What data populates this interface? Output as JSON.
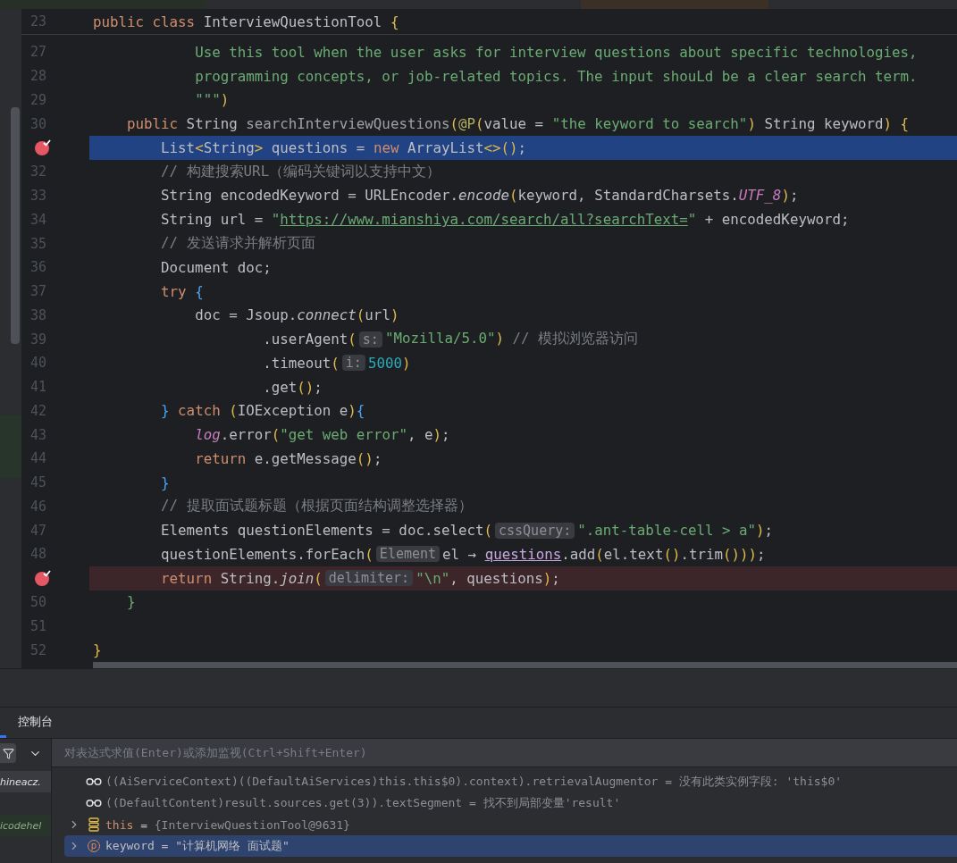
{
  "editor": {
    "sticky_line": {
      "number": "23",
      "tokens": [
        {
          "kind": "kw",
          "text": "public class"
        },
        {
          "kind": "plain",
          "text": " InterviewQuestionTool "
        },
        {
          "kind": "py",
          "text": "{"
        }
      ]
    },
    "lines": [
      {
        "children": [
          {
            "children": [
              {
                "children": [
                  {
                    "number": "27",
                    "breakpoint": false,
                    "current": false,
                    "tokens": [
                      {
                        "kind": "str",
                        "text": "Use this tool when the user asks for interview questions about specific technologies,"
                      }
                    ]
                  },
                  {
                    "number": "28",
                    "breakpoint": false,
                    "current": false,
                    "tokens": [
                      {
                        "kind": "str",
                        "text": "programming concepts, or job-related topics. The input shouLd be a clear search term."
                      }
                    ]
                  },
                  {
                    "number": "29",
                    "breakpoint": false,
                    "current": false,
                    "tokens": [
                      {
                        "kind": "str",
                        "text": "\"\"\""
                      },
                      {
                        "kind": "py",
                        "text": ")"
                      }
                    ]
                  }
                ]
              }
            ]
          }
        ]
      },
      {
        "children": [
          {
            "number": "30",
            "breakpoint": false,
            "current": false,
            "tokens": [
              {
                "kind": "kw",
                "text": "public"
              },
              {
                "kind": "plain",
                "text": " String "
              },
              {
                "kind": "decl",
                "text": "searchInterviewQuestions"
              },
              {
                "kind": "py",
                "text": "("
              },
              {
                "kind": "an",
                "text": "@P"
              },
              {
                "kind": "py",
                "text": "("
              },
              {
                "kind": "plain",
                "text": "value = "
              },
              {
                "kind": "str",
                "text": "\"the keyword to search\""
              },
              {
                "kind": "py",
                "text": ")"
              },
              {
                "kind": "plain",
                "text": " String keyword"
              },
              {
                "kind": "py",
                "text": ") {"
              }
            ],
            "children": [
              {
                "breakpoint": true,
                "current": true,
                "tokens": [
                  {
                    "kind": "plain",
                    "text": "List"
                  },
                  {
                    "kind": "py",
                    "text": "<"
                  },
                  {
                    "kind": "plain",
                    "text": "String"
                  },
                  {
                    "kind": "py",
                    "text": ">"
                  },
                  {
                    "kind": "plain",
                    "text": " questions = "
                  },
                  {
                    "kind": "kw",
                    "text": "new"
                  },
                  {
                    "kind": "plain",
                    "text": " ArrayList"
                  },
                  {
                    "kind": "py",
                    "text": "<>()"
                  },
                  {
                    "kind": "plain",
                    "text": ";"
                  }
                ]
              },
              {
                "number": "32",
                "breakpoint": false,
                "current": false,
                "tokens": [
                  {
                    "kind": "cm",
                    "text": "// 构建搜索URL（编码关键词以支持中文）"
                  }
                ]
              },
              {
                "number": "33",
                "breakpoint": false,
                "current": false,
                "tokens": [
                  {
                    "kind": "plain",
                    "text": "String encodedKeyword = URLEncoder."
                  },
                  {
                    "kind": "it",
                    "text": "encode"
                  },
                  {
                    "kind": "py",
                    "text": "("
                  },
                  {
                    "kind": "plain",
                    "text": "keyword, StandardCharsets."
                  },
                  {
                    "kind": "st",
                    "text": "UTF_8"
                  },
                  {
                    "kind": "py",
                    "text": ")"
                  },
                  {
                    "kind": "plain",
                    "text": ";"
                  }
                ]
              },
              {
                "number": "34",
                "breakpoint": false,
                "current": false,
                "tokens": [
                  {
                    "kind": "plain",
                    "text": "String url = "
                  },
                  {
                    "kind": "str",
                    "text": "\""
                  },
                  {
                    "kind": "link",
                    "text": "https://www.mianshiya.com/search/all?searchText="
                  },
                  {
                    "kind": "str",
                    "text": "\""
                  },
                  {
                    "kind": "plain",
                    "text": " + encodedKeyword;"
                  }
                ]
              },
              {
                "number": "35",
                "breakpoint": false,
                "current": false,
                "tokens": [
                  {
                    "kind": "cm",
                    "text": "// 发送请求并解析页面"
                  }
                ]
              },
              {
                "number": "36",
                "breakpoint": false,
                "current": false,
                "tokens": [
                  {
                    "kind": "plain",
                    "text": "Document doc;"
                  }
                ]
              },
              {
                "number": "37",
                "breakpoint": false,
                "current": false,
                "tokens": [
                  {
                    "kind": "kw",
                    "text": "try"
                  },
                  {
                    "kind": "pb",
                    "text": " {"
                  }
                ],
                "children": [
                  {
                    "number": "38",
                    "breakpoint": false,
                    "current": false,
                    "tokens": [
                      {
                        "kind": "plain",
                        "text": "doc = Jsoup."
                      },
                      {
                        "kind": "it",
                        "text": "connect"
                      },
                      {
                        "kind": "py",
                        "text": "("
                      },
                      {
                        "kind": "plain",
                        "text": "url"
                      },
                      {
                        "kind": "py",
                        "text": ")"
                      }
                    ],
                    "children": [
                      {
                        "children": [
                          {
                            "number": "39",
                            "breakpoint": false,
                            "current": false,
                            "tokens": [
                              {
                                "kind": "plain",
                                "text": ".userAgent"
                              },
                              {
                                "kind": "py",
                                "text": "("
                              },
                              {
                                "kind": "hint",
                                "text": "s:"
                              },
                              {
                                "kind": "str",
                                "text": "\"Mozilla/5.0\""
                              },
                              {
                                "kind": "py",
                                "text": ")"
                              },
                              {
                                "kind": "cm",
                                "text": " // 模拟浏览器访问"
                              }
                            ]
                          },
                          {
                            "number": "40",
                            "breakpoint": false,
                            "current": false,
                            "tokens": [
                              {
                                "kind": "plain",
                                "text": ".timeout"
                              },
                              {
                                "kind": "py",
                                "text": "("
                              },
                              {
                                "kind": "hint",
                                "text": "i:"
                              },
                              {
                                "kind": "num",
                                "text": "5000"
                              },
                              {
                                "kind": "py",
                                "text": ")"
                              }
                            ]
                          },
                          {
                            "number": "41",
                            "breakpoint": false,
                            "current": false,
                            "tokens": [
                              {
                                "kind": "plain",
                                "text": ".get"
                              },
                              {
                                "kind": "py",
                                "text": "()"
                              },
                              {
                                "kind": "plain",
                                "text": ";"
                              }
                            ]
                          }
                        ]
                      }
                    ]
                  }
                ]
              },
              {
                "number": "42",
                "breakpoint": false,
                "current": false,
                "tokens": [
                  {
                    "kind": "pb",
                    "text": "} "
                  },
                  {
                    "kind": "kw",
                    "text": "catch"
                  },
                  {
                    "kind": "py",
                    "text": " ("
                  },
                  {
                    "kind": "plain",
                    "text": "IOException e"
                  },
                  {
                    "kind": "py",
                    "text": ")"
                  },
                  {
                    "kind": "pb",
                    "text": "{"
                  }
                ],
                "children": [
                  {
                    "number": "43",
                    "breakpoint": false,
                    "current": false,
                    "tokens": [
                      {
                        "kind": "st",
                        "text": "log"
                      },
                      {
                        "kind": "plain",
                        "text": ".error"
                      },
                      {
                        "kind": "py",
                        "text": "("
                      },
                      {
                        "kind": "str",
                        "text": "\"get web error\""
                      },
                      {
                        "kind": "plain",
                        "text": ", e"
                      },
                      {
                        "kind": "py",
                        "text": ")"
                      },
                      {
                        "kind": "plain",
                        "text": ";"
                      }
                    ]
                  },
                  {
                    "number": "44",
                    "breakpoint": false,
                    "current": false,
                    "tokens": [
                      {
                        "kind": "kw",
                        "text": "return"
                      },
                      {
                        "kind": "plain",
                        "text": " e.getMessage"
                      },
                      {
                        "kind": "py",
                        "text": "()"
                      },
                      {
                        "kind": "plain",
                        "text": ";"
                      }
                    ]
                  }
                ]
              },
              {
                "number": "45",
                "breakpoint": false,
                "current": false,
                "tokens": [
                  {
                    "kind": "pb",
                    "text": "}"
                  }
                ]
              },
              {
                "number": "46",
                "breakpoint": false,
                "current": false,
                "tokens": [
                  {
                    "kind": "cm",
                    "text": "// 提取面试题标题（根据页面结构调整选择器）"
                  }
                ]
              },
              {
                "number": "47",
                "breakpoint": false,
                "current": false,
                "tokens": [
                  {
                    "kind": "plain",
                    "text": "Elements questionElements = doc.select"
                  },
                  {
                    "kind": "py",
                    "text": "("
                  },
                  {
                    "kind": "hint",
                    "text": "cssQuery:"
                  },
                  {
                    "kind": "str",
                    "text": "\".ant-table-cell > a\""
                  },
                  {
                    "kind": "py",
                    "text": ")"
                  },
                  {
                    "kind": "plain",
                    "text": ";"
                  }
                ]
              },
              {
                "number": "48",
                "breakpoint": false,
                "current": false,
                "tokens": [
                  {
                    "kind": "plain",
                    "text": "questionElements.forEach"
                  },
                  {
                    "kind": "py",
                    "text": "("
                  },
                  {
                    "kind": "hint",
                    "text": "Element"
                  },
                  {
                    "kind": "plain",
                    "text": "el → "
                  },
                  {
                    "kind": "cap",
                    "text": "questions"
                  },
                  {
                    "kind": "plain",
                    "text": ".add"
                  },
                  {
                    "kind": "py",
                    "text": "("
                  },
                  {
                    "kind": "plain",
                    "text": "el.text"
                  },
                  {
                    "kind": "py",
                    "text": "()"
                  },
                  {
                    "kind": "plain",
                    "text": ".trim"
                  },
                  {
                    "kind": "py",
                    "text": "()))"
                  },
                  {
                    "kind": "plain",
                    "text": ";"
                  }
                ]
              },
              {
                "breakpoint": true,
                "current": false,
                "tokens": [
                  {
                    "kind": "kw",
                    "text": "return"
                  },
                  {
                    "kind": "plain",
                    "text": " String."
                  },
                  {
                    "kind": "it",
                    "text": "join"
                  },
                  {
                    "kind": "py",
                    "text": "("
                  },
                  {
                    "kind": "hint",
                    "text": "delimiter:"
                  },
                  {
                    "kind": "str",
                    "text": "\"\\n\""
                  },
                  {
                    "kind": "plain",
                    "text": ", questions"
                  },
                  {
                    "kind": "py",
                    "text": ")"
                  },
                  {
                    "kind": "plain",
                    "text": ";"
                  }
                ]
              }
            ]
          },
          {
            "number": "50",
            "breakpoint": false,
            "current": false,
            "tokens": [
              {
                "kind": "pg",
                "text": "}"
              }
            ]
          }
        ]
      },
      {
        "number": "51",
        "breakpoint": false,
        "current": false
      },
      {
        "number": "52",
        "breakpoint": false,
        "current": false,
        "tokens": [
          {
            "kind": "py",
            "text": "}"
          }
        ]
      }
    ]
  },
  "debug_panel": {
    "tabs": [
      {
        "label": "控制台",
        "selected": false
      }
    ],
    "expression_field": {
      "placeholder": "对表达式求值(Enter)或添加监视(Ctrl+Shift+Enter)"
    },
    "frames": [
      {
        "label": "hineacz.",
        "selected": true,
        "kind": "user"
      },
      {
        "label": "icodehel",
        "selected": false,
        "kind": "library"
      }
    ],
    "variables": [
      {
        "kind": "watch",
        "selected": false,
        "tokens": [
          {
            "kind": "grey",
            "text": "((AiServiceContext)((DefaultAiServices)this.this$0).context).retrievalAugmentor = 没有此类实例字段: 'this$0'"
          }
        ]
      },
      {
        "kind": "watch",
        "selected": false,
        "tokens": [
          {
            "kind": "grey",
            "text": "((DefaultContent)result.sources.get(3)).textSegment = 找不到局部变量'result'"
          }
        ]
      },
      {
        "kind": "object",
        "selected": false,
        "tokens": [
          {
            "kind": "kw",
            "text": "this"
          },
          {
            "kind": "plain",
            "text": " = "
          },
          {
            "kind": "grey",
            "text": "{InterviewQuestionTool@9631}"
          }
        ]
      },
      {
        "kind": "parameter",
        "badge": "p",
        "selected": true,
        "tokens": [
          {
            "kind": "plain",
            "text": "keyword = \"计算机网络 面试题\""
          }
        ]
      }
    ]
  }
}
